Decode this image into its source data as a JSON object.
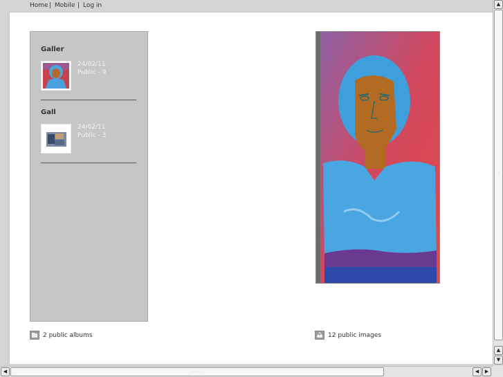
{
  "nav": {
    "home": "Home",
    "separator": "|",
    "mobile": "Mobile",
    "login": "Log in"
  },
  "albums": [
    {
      "title": "Galler",
      "date": "24/02/11",
      "count": "Public - 9"
    },
    {
      "title": "Gall",
      "date": "24/02/11",
      "count": "Public - 3"
    }
  ],
  "footer": {
    "albums_text": "2 public albums",
    "images_text": "12 public images"
  },
  "colors": {
    "panel_bg": "#c6c6c6",
    "page_bg": "#ffffff",
    "chrome_bg": "#d4d4d4"
  },
  "icons": {
    "albums": "folder-icon",
    "images": "photo-upload-icon"
  }
}
